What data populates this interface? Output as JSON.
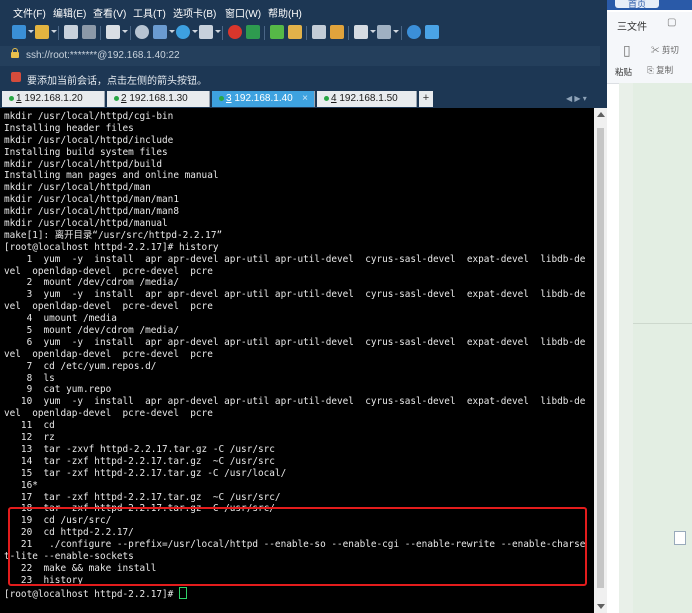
{
  "menu": [
    "文件(F)",
    "编辑(E)",
    "查看(V)",
    "工具(T)",
    "选项卡(B)",
    "窗口(W)",
    "帮助(H)"
  ],
  "toolbar_icons": [
    "new-session-icon",
    "open-folder-icon",
    "connect-icon",
    "disconnect-icon",
    "properties-icon",
    "search-icon",
    "transfer-icon",
    "globe-icon",
    "font-icon",
    "color-icon",
    "sftp-icon",
    "fullscreen-icon",
    "lock-icon",
    "keyboard-icon",
    "compose-icon",
    "layout-icon",
    "tabs-icon",
    "help-icon",
    "chat-icon"
  ],
  "address": "ssh://root:*******@192.168.1.40:22",
  "hint": "要添加当前会话，点击左侧的箭头按钮。",
  "tabs": [
    {
      "num": "1",
      "label": "192.168.1.20",
      "active": false
    },
    {
      "num": "2",
      "label": "192.168.1.30",
      "active": false
    },
    {
      "num": "3",
      "label": "192.168.1.40",
      "active": true
    },
    {
      "num": "4",
      "label": "192.168.1.50",
      "active": false
    }
  ],
  "tab_add": "+",
  "terminal": {
    "lines": [
      "mkdir /usr/local/httpd/cgi-bin",
      "Installing header files",
      "mkdir /usr/local/httpd/include",
      "Installing build system files",
      "mkdir /usr/local/httpd/build",
      "Installing man pages and online manual",
      "mkdir /usr/local/httpd/man",
      "mkdir /usr/local/httpd/man/man1",
      "mkdir /usr/local/httpd/man/man8",
      "mkdir /usr/local/httpd/manual",
      "make[1]: 离开目录“/usr/src/httpd-2.2.17”",
      "[root@localhost httpd-2.2.17]# history",
      "    1  yum  -y  install  apr apr-devel apr-util apr-util-devel  cyrus-sasl-devel  expat-devel  libdb-de",
      "vel  openldap-devel  pcre-devel  pcre",
      "    2  mount /dev/cdrom /media/",
      "    3  yum  -y  install  apr apr-devel apr-util apr-util-devel  cyrus-sasl-devel  expat-devel  libdb-de",
      "vel  openldap-devel  pcre-devel  pcre",
      "    4  umount /media",
      "    5  mount /dev/cdrom /media/",
      "    6  yum  -y  install  apr apr-devel apr-util apr-util-devel  cyrus-sasl-devel  expat-devel  libdb-de",
      "vel  openldap-devel  pcre-devel  pcre",
      "    7  cd /etc/yum.repos.d/",
      "    8  ls",
      "    9  cat yum.repo",
      "   10  yum  -y  install  apr apr-devel apr-util apr-util-devel  cyrus-sasl-devel  expat-devel  libdb-de",
      "vel  openldap-devel  pcre-devel  pcre",
      "   11  cd",
      "   12  rz",
      "   13  tar -zxvf httpd-2.2.17.tar.gz -C /usr/src",
      "   14  tar -zxf httpd-2.2.17.tar.gz  ~C /usr/src",
      "   15  tar -zxf httpd-2.2.17.tar.gz -C /usr/local/",
      "   16*",
      "   17  tar -zxf httpd-2.2.17.tar.gz  ~C /usr/src/",
      "   18  tar -zxf httpd-2.2.17.tar.gz -C /usr/src/",
      "   19  cd /usr/src/",
      "   20  cd httpd-2.2.17/",
      "   21   ./configure --prefix=/usr/local/httpd --enable-so --enable-cgi --enable-rewrite --enable-charse",
      "t-lite --enable-sockets",
      "   22  make && make install",
      "   23  history"
    ],
    "prompt": "[root@localhost httpd-2.2.17]# "
  },
  "side": {
    "tab": "首页",
    "file": "三文件",
    "cut": "剪切",
    "paste": "粘贴",
    "copy": "复制"
  },
  "colors": {
    "window": "#1d3754",
    "active_tab": "#3ea2e0",
    "highlight": "#e31c1c",
    "cursor": "#2fd36a"
  }
}
